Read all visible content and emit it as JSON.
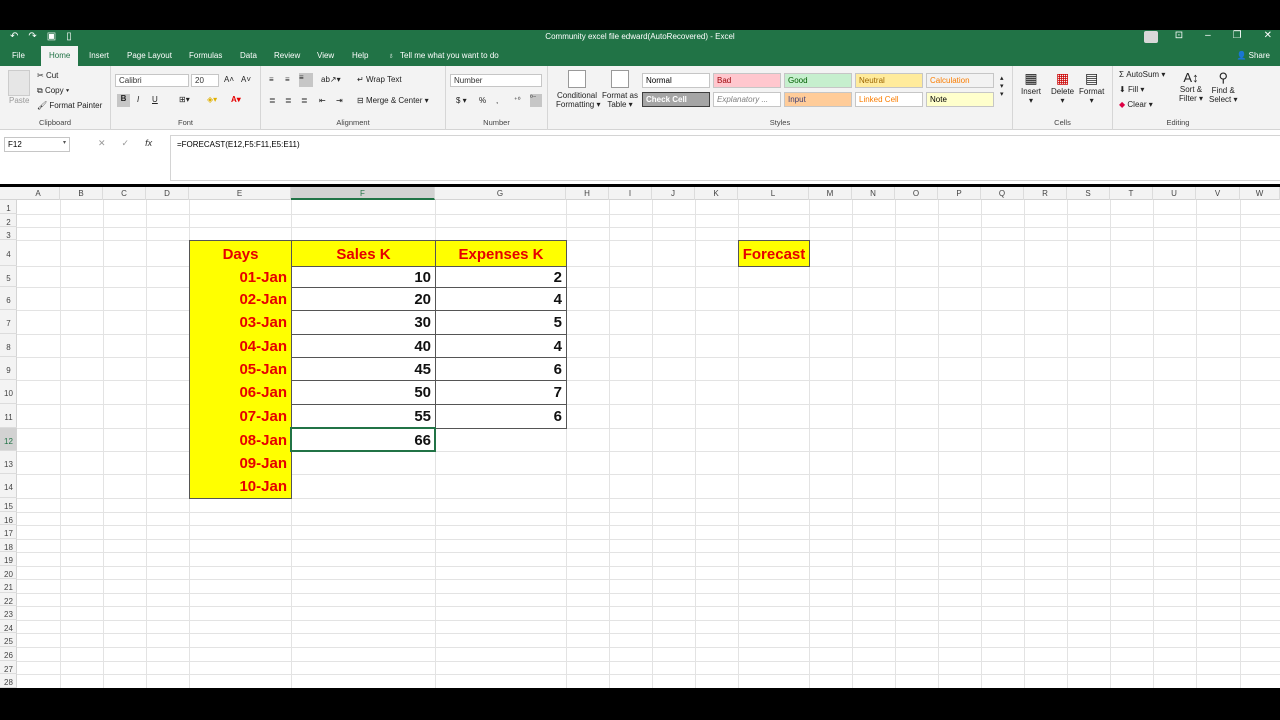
{
  "app": {
    "title": "Community excel file  edward(AutoRecovered)  -  Excel",
    "share_label": "Share"
  },
  "tabs": [
    {
      "label": "File"
    },
    {
      "label": "Home"
    },
    {
      "label": "Insert"
    },
    {
      "label": "Page Layout"
    },
    {
      "label": "Formulas"
    },
    {
      "label": "Data"
    },
    {
      "label": "Review"
    },
    {
      "label": "View"
    },
    {
      "label": "Help"
    }
  ],
  "tell_me": {
    "placeholder": "Tell me what you want to do"
  },
  "ribbon": {
    "clipboard": {
      "paste": "Paste",
      "cut": "Cut",
      "copy": "Copy",
      "format_painter": "Format Painter",
      "label": "Clipboard"
    },
    "font": {
      "name": "Calibri",
      "size": "20",
      "bold": "B",
      "italic": "I",
      "underline": "U",
      "label": "Font"
    },
    "alignment": {
      "wrap": "Wrap Text",
      "merge": "Merge & Center",
      "label": "Alignment"
    },
    "number": {
      "format": "Number",
      "currency": "$",
      "percent": "%",
      "comma": ",",
      "label": "Number"
    },
    "styles": {
      "conditional": [
        "Conditional",
        "Formatting"
      ],
      "format_table": [
        "Format as",
        "Table"
      ],
      "items": [
        {
          "label": "Normal",
          "bg": "#ffffff",
          "fg": "#000000"
        },
        {
          "label": "Bad",
          "bg": "#ffc7ce",
          "fg": "#9c0006"
        },
        {
          "label": "Good",
          "bg": "#c6efce",
          "fg": "#006100"
        },
        {
          "label": "Neutral",
          "bg": "#ffeb9c",
          "fg": "#9c6500"
        },
        {
          "label": "Calculation",
          "bg": "#f2f2f2",
          "fg": "#fa7d00"
        },
        {
          "label": "Check Cell",
          "bg": "#a5a5a5",
          "fg": "#ffffff"
        },
        {
          "label": "Explanatory ...",
          "bg": "#ffffff",
          "fg": "#7f7f7f"
        },
        {
          "label": "Input",
          "bg": "#ffcc99",
          "fg": "#3f3f76"
        },
        {
          "label": "Linked Cell",
          "bg": "#ffffff",
          "fg": "#fa7d00"
        },
        {
          "label": "Note",
          "bg": "#ffffcc",
          "fg": "#000000"
        }
      ],
      "label": "Styles"
    },
    "cells": {
      "insert": "Insert",
      "delete": "Delete",
      "format": "Format",
      "label": "Cells"
    },
    "editing": {
      "autosum": "AutoSum",
      "fill": "Fill",
      "clear": "Clear",
      "sort": [
        "Sort &",
        "Filter"
      ],
      "find": [
        "Find &",
        "Select"
      ],
      "label": "Editing"
    }
  },
  "formula_bar": {
    "name_box": "F12",
    "formula": "=FORECAST(E12,F5:F11,E5:E11)",
    "fx": "fx"
  },
  "columns": [
    "A",
    "B",
    "C",
    "D",
    "E",
    "F",
    "G",
    "H",
    "I",
    "J",
    "K",
    "L",
    "M",
    "N",
    "O",
    "P",
    "Q",
    "R",
    "S",
    "T",
    "U",
    "V",
    "W"
  ],
  "rows": [
    "1",
    "2",
    "3",
    "4",
    "5",
    "6",
    "7",
    "8",
    "9",
    "10",
    "11",
    "12",
    "13",
    "14",
    "15",
    "16",
    "17",
    "18",
    "19",
    "20",
    "21",
    "22",
    "23",
    "24",
    "25",
    "26",
    "27",
    "28"
  ],
  "table": {
    "headers": [
      "Days",
      "Sales K",
      "Expenses K"
    ],
    "days": [
      "01-Jan",
      "02-Jan",
      "03-Jan",
      "04-Jan",
      "05-Jan",
      "06-Jan",
      "07-Jan",
      "08-Jan",
      "09-Jan",
      "10-Jan"
    ],
    "sales": [
      "10",
      "20",
      "30",
      "40",
      "45",
      "50",
      "55",
      "66"
    ],
    "expenses": [
      "2",
      "4",
      "5",
      "4",
      "6",
      "7",
      "6"
    ]
  },
  "forecast_label": "Forecast",
  "colors": {
    "excel_green": "#217346",
    "header_yellow": "#ffff00",
    "header_red": "#e60000"
  }
}
